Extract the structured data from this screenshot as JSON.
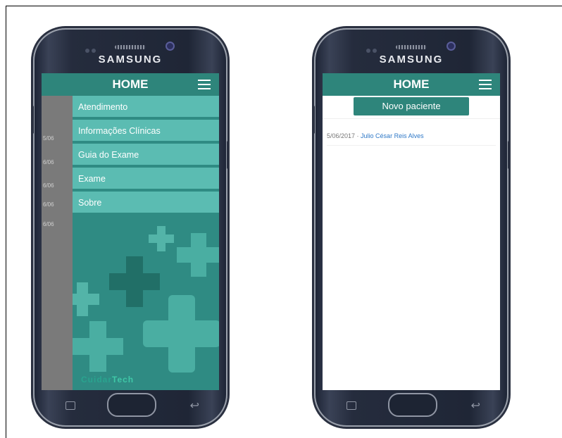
{
  "left_phone": {
    "brand": "SAMSUNG",
    "app_title": "HOME",
    "menu": [
      {
        "label": "Atendimento"
      },
      {
        "label": "Informações Clínicas"
      },
      {
        "label": "Guia do Exame"
      },
      {
        "label": "Exame"
      },
      {
        "label": "Sobre"
      }
    ],
    "underlay_dates": [
      "5/06",
      "6/06",
      "6/06",
      "6/06",
      "6/06"
    ],
    "logo_part1": "Cuidar",
    "logo_part2": "Tech"
  },
  "right_phone": {
    "brand": "SAMSUNG",
    "app_title": "HOME",
    "new_patient_button": "Novo paciente",
    "patients": [
      {
        "date": "5/06/2017",
        "separator": " · ",
        "name": "Julio César Reis Alves"
      }
    ]
  },
  "colors": {
    "accent": "#2e857b",
    "menu_item": "#5bbcb2",
    "drawer": "#2f8b83",
    "link": "#2e78c7"
  },
  "icons": [
    "hamburger-menu-icon",
    "recent-apps-icon",
    "home-button",
    "back-icon"
  ]
}
